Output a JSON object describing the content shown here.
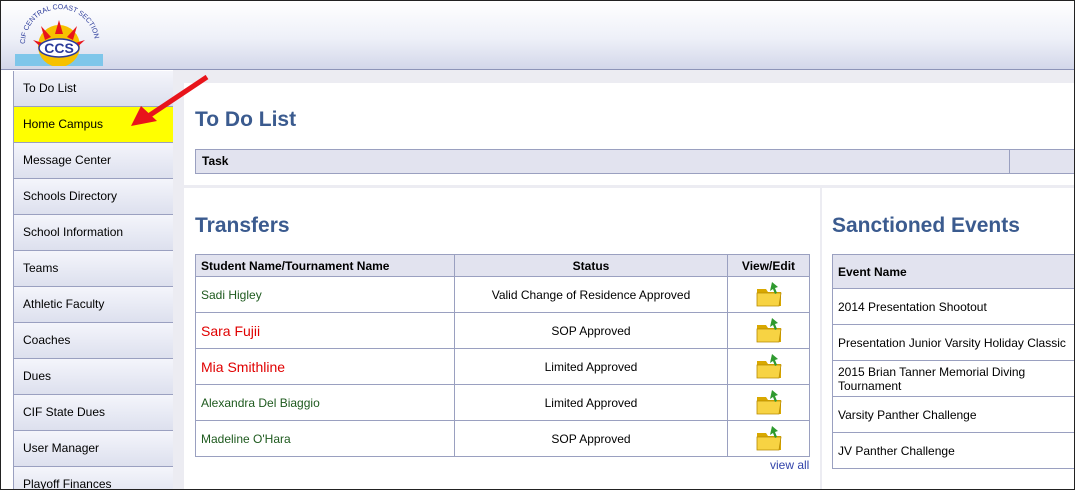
{
  "header": {
    "logo_alt": "CIF Central Coast Section",
    "logo_arc_text": "CIF CENTRAL COAST SECTION",
    "logo_text": "CCS"
  },
  "sidebar": {
    "items": [
      {
        "label": "To Do List"
      },
      {
        "label": "Home Campus"
      },
      {
        "label": "Message Center"
      },
      {
        "label": "Schools Directory"
      },
      {
        "label": "School Information"
      },
      {
        "label": "Teams"
      },
      {
        "label": "Athletic Faculty"
      },
      {
        "label": "Coaches"
      },
      {
        "label": "Dues"
      },
      {
        "label": "CIF State Dues"
      },
      {
        "label": "User Manager"
      },
      {
        "label": "Playoff Finances"
      }
    ]
  },
  "todo": {
    "title": "To Do List",
    "task_header": "Task"
  },
  "transfers": {
    "title": "Transfers",
    "columns": [
      "Student Name/Tournament Name",
      "Status",
      "View/Edit"
    ],
    "rows": [
      {
        "name": "Sadi Higley",
        "status": "Valid Change of Residence Approved"
      },
      {
        "name": "Sara Fujii",
        "status": "SOP Approved"
      },
      {
        "name": "Mia Smithline",
        "status": "Limited Approved"
      },
      {
        "name": "Alexandra Del Biaggio",
        "status": "Limited Approved"
      },
      {
        "name": "Madeline O'Hara",
        "status": "SOP Approved"
      }
    ],
    "view_all": "view all"
  },
  "events": {
    "title": "Sanctioned Events",
    "column": "Event Name",
    "rows": [
      "2014 Presentation Shootout",
      "Presentation Junior Varsity Holiday Classic",
      "2015 Brian Tanner Memorial Diving Tournament",
      "Varsity Panther Challenge",
      "JV Panther Challenge"
    ]
  },
  "colors": {
    "accent_title": "#3b5b8f",
    "highlight": "#ffff00",
    "arrow": "#e8141b",
    "name_green": "#1e5a1e",
    "name_red": "#e00000"
  },
  "icons": {
    "folder": "folder-edit-icon",
    "arrow": "red-arrow-annotation"
  }
}
